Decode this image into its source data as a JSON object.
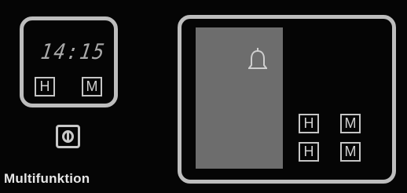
{
  "clock": {
    "time": "14:15",
    "hour_key": "H",
    "minute_key": "M"
  },
  "mode": {
    "label": "Multifunktion"
  },
  "timer": {
    "icon": "bell-icon",
    "hour_key_1": "H",
    "minute_key_1": "M",
    "hour_key_2": "H",
    "minute_key_2": "M"
  }
}
